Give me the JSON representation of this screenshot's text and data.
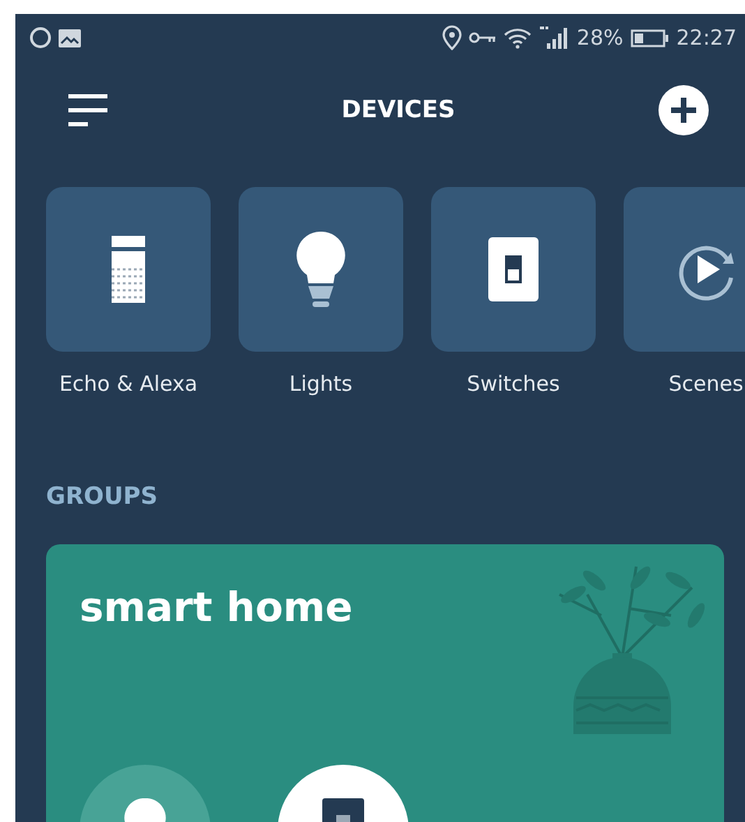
{
  "status_bar": {
    "battery_percent": "28%",
    "time": "22:27"
  },
  "header": {
    "title": "DEVICES"
  },
  "categories": [
    {
      "kind": "echo",
      "label": "Echo & Alexa"
    },
    {
      "kind": "light",
      "label": "Lights"
    },
    {
      "kind": "switch",
      "label": "Switches"
    },
    {
      "kind": "scenes",
      "label": "Scenes"
    }
  ],
  "groups": {
    "heading": "GROUPS",
    "cards": [
      {
        "name": "smart home",
        "devices": [
          {
            "kind": "light",
            "on": false
          },
          {
            "kind": "switch",
            "on": true
          }
        ]
      }
    ]
  }
}
